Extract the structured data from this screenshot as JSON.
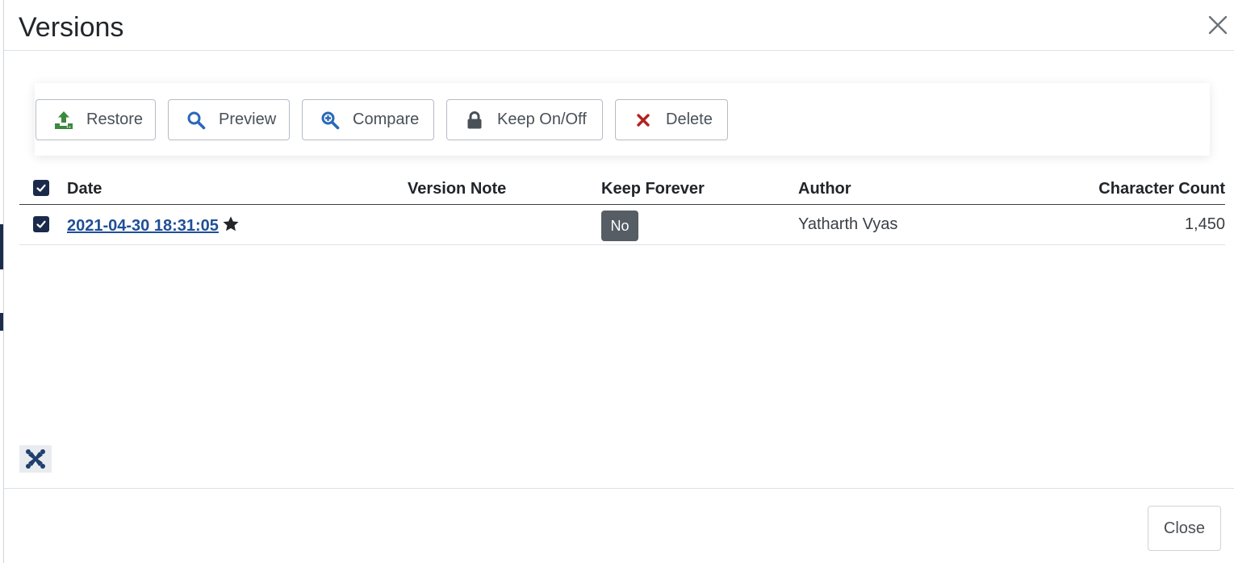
{
  "modal": {
    "title": "Versions",
    "close_icon": "close-icon"
  },
  "toolbar": {
    "buttons": [
      {
        "label": "Restore",
        "icon": "upload-icon",
        "color": "#3c8a3e"
      },
      {
        "label": "Preview",
        "icon": "search-icon",
        "color": "#2a69b8"
      },
      {
        "label": "Compare",
        "icon": "zoom-in-icon",
        "color": "#2a69b8"
      },
      {
        "label": "Keep On/Off",
        "icon": "lock-icon",
        "color": "#495057"
      },
      {
        "label": "Delete",
        "icon": "times-icon",
        "color": "#b22222"
      }
    ]
  },
  "table": {
    "columns": [
      "Date",
      "Version Note",
      "Keep Forever",
      "Author",
      "Character Count"
    ],
    "rows": [
      {
        "checked": true,
        "date": "2021-04-30 18:31:05",
        "starred": true,
        "version_note": "",
        "keep_forever": "No",
        "author": "Yatharth Vyas",
        "character_count": "1,450"
      }
    ]
  },
  "footer": {
    "close_label": "Close"
  },
  "colors": {
    "checkbox": "#1b2a4a",
    "link": "#1f4f96",
    "badge": "#565d64"
  }
}
